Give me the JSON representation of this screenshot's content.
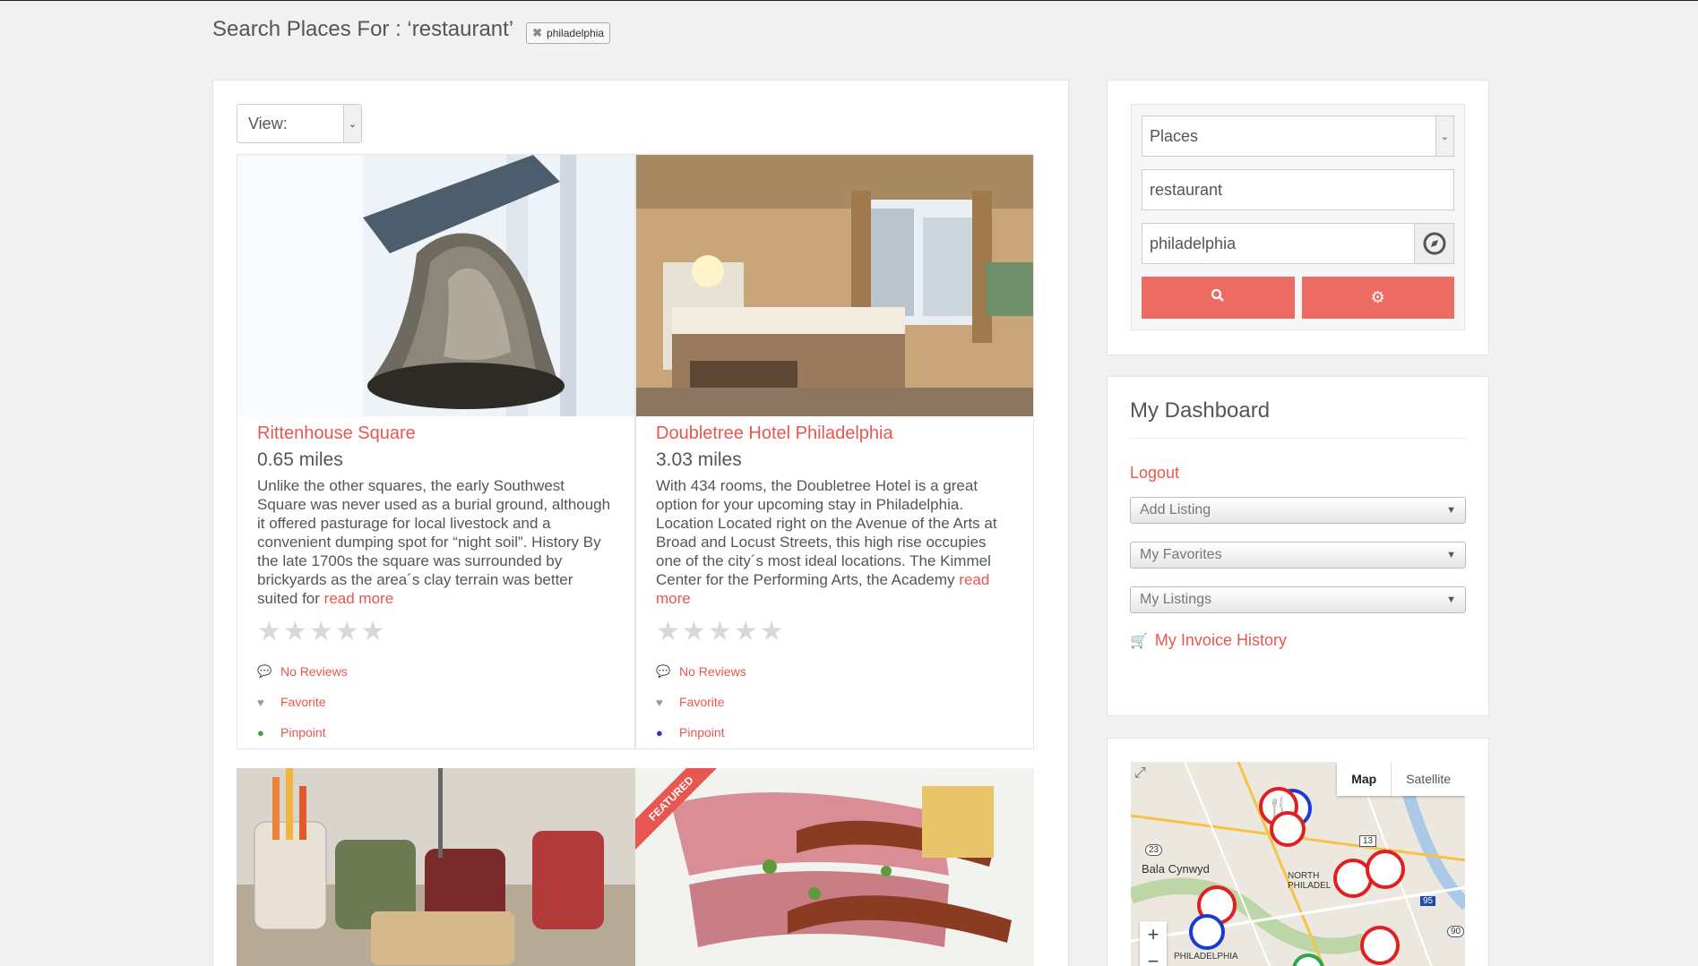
{
  "search": {
    "heading": "Search Places For : ‘restaurant’",
    "tag": "philadelphia",
    "view_label": "View:"
  },
  "listings": [
    {
      "title": "Rittenhouse Square",
      "distance": "0.65 miles",
      "description": "Unlike the other squares, the early Southwest Square was never used as a burial ground, although it offered pasturage for local livestock and a convenient dumping spot for “night soil”. History By the late 1700s the square was surrounded by brickyards as the area´s clay terrain was better suited for",
      "read_more": "read more",
      "reviews": "No Reviews",
      "favorite": "Favorite",
      "pinpoint": "Pinpoint"
    },
    {
      "title": "Doubletree Hotel Philadelphia",
      "distance": "3.03 miles",
      "description": "With 434 rooms, the Doubletree Hotel is a great option for your upcoming stay in Philadelphia. Location Located right on the Avenue of the Arts at Broad and Locust Streets, this high rise occupies one of the city´s most ideal locations. The Kimmel Center for the Performing Arts, the Academy",
      "read_more": "read more",
      "reviews": "No Reviews",
      "favorite": "Favorite",
      "pinpoint": "Pinpoint"
    }
  ],
  "featured_label": "FEATURED",
  "sidebar": {
    "type_select": "Places",
    "keyword": "restaurant",
    "location": "philadelphia",
    "dashboard_title": "My Dashboard",
    "logout": "Logout",
    "add_listing": "Add Listing",
    "my_favorites": "My Favorites",
    "my_listings": "My Listings",
    "invoice_history": "My Invoice History"
  },
  "map": {
    "tab_map": "Map",
    "tab_satellite": "Satellite",
    "label_bala": "Bala Cynwyd",
    "label_north": "NORTH PHILADEL",
    "label_philly": "PHILADELPHIA",
    "route_23": "23",
    "route_13": "13",
    "route_95": "95",
    "route_90": "90",
    "zoom_in": "+",
    "zoom_out": "−"
  },
  "colors": {
    "accent": "#e8574f",
    "button": "#ec6b62"
  }
}
